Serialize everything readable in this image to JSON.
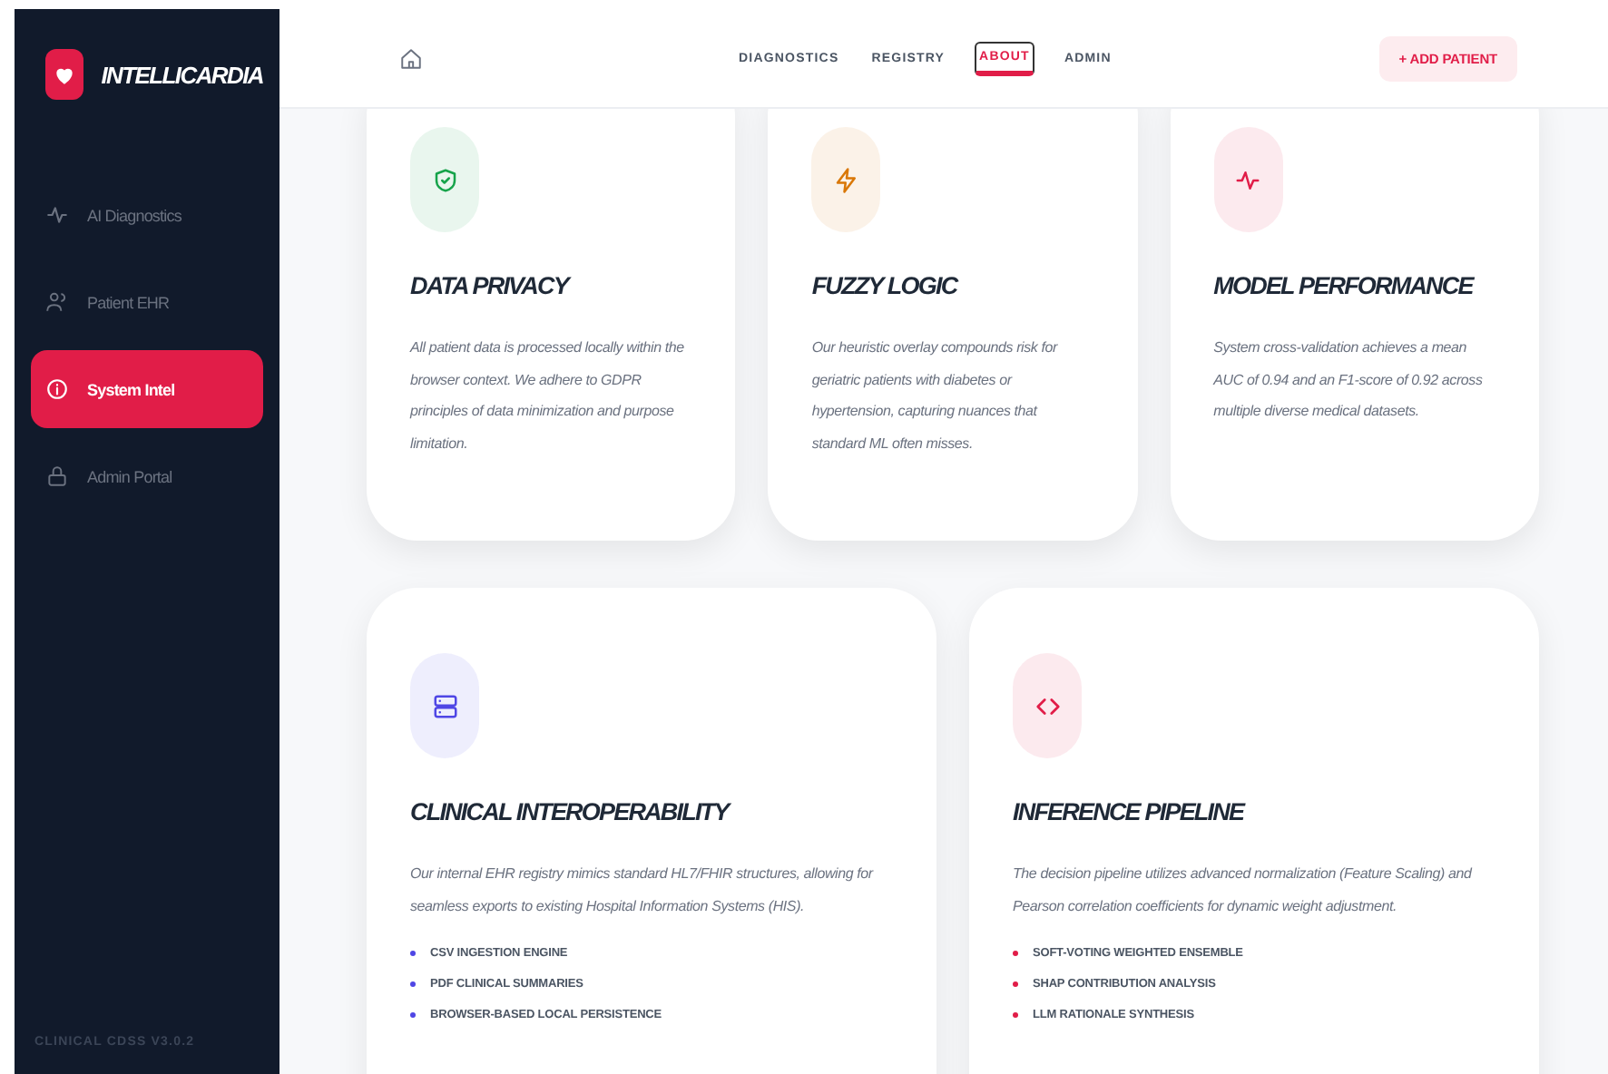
{
  "brand": {
    "name": "INTELLICARDIA"
  },
  "sidebar": {
    "items": [
      {
        "label": "AI Diagnostics",
        "selected": false
      },
      {
        "label": "Patient EHR",
        "selected": false
      },
      {
        "label": "System Intel",
        "selected": true
      },
      {
        "label": "Admin Portal",
        "selected": false
      }
    ],
    "footer": "CLINICAL CDSS V3.0.2"
  },
  "header": {
    "tabs": [
      {
        "label": "DIAGNOSTICS",
        "selected": false
      },
      {
        "label": "REGISTRY",
        "selected": false
      },
      {
        "label": "ABOUT",
        "selected": true
      },
      {
        "label": "ADMIN",
        "selected": false
      }
    ],
    "action": "+ ADD PATIENT"
  },
  "top_cards": [
    {
      "color": "#16a34a",
      "title": "DATA PRIVACY",
      "text": "All patient data is processed locally within the browser context. We adhere to GDPR principles of data minimization and purpose limitation."
    },
    {
      "color": "#d97706",
      "title": "FUZZY LOGIC",
      "text": "Our heuristic overlay compounds risk for geriatric patients with diabetes or hypertension, capturing nuances that standard ML often misses."
    },
    {
      "color": "#e11d48",
      "title": "MODEL PERFORMANCE",
      "text": "System cross-validation achieves a mean AUC of 0.94 and an F1-score of 0.92 across multiple diverse medical datasets."
    }
  ],
  "bottom_cards": [
    {
      "color": "#4f46e5",
      "title": "CLINICAL INTEROPERABILITY",
      "text": "Our internal EHR registry mimics standard HL7/FHIR structures, allowing for seamless exports to existing Hospital Information Systems (HIS).",
      "bullets": [
        "CSV INGESTION ENGINE",
        "PDF CLINICAL SUMMARIES",
        "BROWSER-BASED LOCAL PERSISTENCE"
      ]
    },
    {
      "color": "#e11d48",
      "title": "INFERENCE PIPELINE",
      "text": "The decision pipeline utilizes advanced normalization (Feature Scaling) and Pearson correlation coefficients for dynamic weight adjustment.",
      "bullets": [
        "SOFT-VOTING WEIGHTED ENSEMBLE",
        "SHAP CONTRIBUTION ANALYSIS",
        "LLM RATIONALE SYNTHESIS"
      ]
    }
  ]
}
